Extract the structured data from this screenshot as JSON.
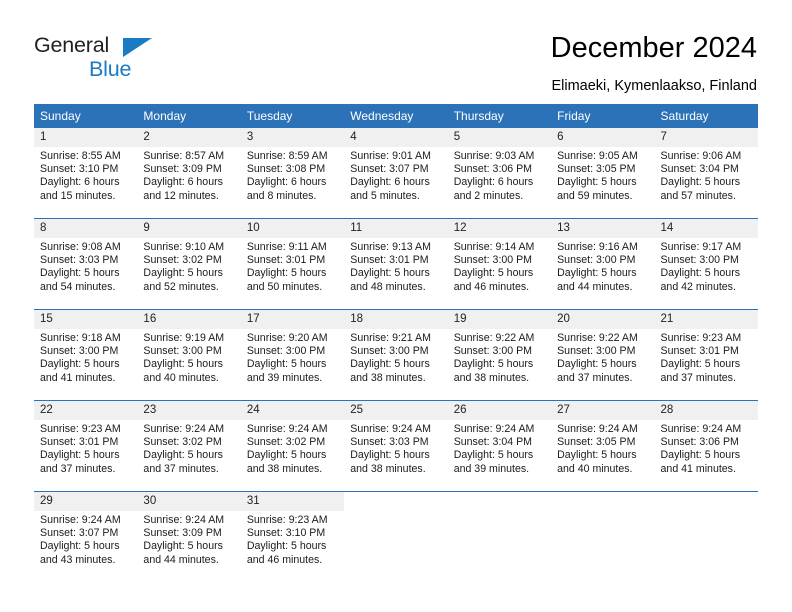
{
  "brand": {
    "name_dark": "General",
    "name_blue": "Blue",
    "accent_blue": "#1a7ac4",
    "header_blue": "#2c72b8",
    "daynum_bg": "#f0f0f0"
  },
  "header": {
    "title": "December 2024",
    "subtitle": "Elimaeki, Kymenlaakso, Finland"
  },
  "weekdays": [
    "Sunday",
    "Monday",
    "Tuesday",
    "Wednesday",
    "Thursday",
    "Friday",
    "Saturday"
  ],
  "weeks": [
    [
      {
        "day": "1",
        "sunrise": "Sunrise: 8:55 AM",
        "sunset": "Sunset: 3:10 PM",
        "daylight1": "Daylight: 6 hours",
        "daylight2": "and 15 minutes."
      },
      {
        "day": "2",
        "sunrise": "Sunrise: 8:57 AM",
        "sunset": "Sunset: 3:09 PM",
        "daylight1": "Daylight: 6 hours",
        "daylight2": "and 12 minutes."
      },
      {
        "day": "3",
        "sunrise": "Sunrise: 8:59 AM",
        "sunset": "Sunset: 3:08 PM",
        "daylight1": "Daylight: 6 hours",
        "daylight2": "and 8 minutes."
      },
      {
        "day": "4",
        "sunrise": "Sunrise: 9:01 AM",
        "sunset": "Sunset: 3:07 PM",
        "daylight1": "Daylight: 6 hours",
        "daylight2": "and 5 minutes."
      },
      {
        "day": "5",
        "sunrise": "Sunrise: 9:03 AM",
        "sunset": "Sunset: 3:06 PM",
        "daylight1": "Daylight: 6 hours",
        "daylight2": "and 2 minutes."
      },
      {
        "day": "6",
        "sunrise": "Sunrise: 9:05 AM",
        "sunset": "Sunset: 3:05 PM",
        "daylight1": "Daylight: 5 hours",
        "daylight2": "and 59 minutes."
      },
      {
        "day": "7",
        "sunrise": "Sunrise: 9:06 AM",
        "sunset": "Sunset: 3:04 PM",
        "daylight1": "Daylight: 5 hours",
        "daylight2": "and 57 minutes."
      }
    ],
    [
      {
        "day": "8",
        "sunrise": "Sunrise: 9:08 AM",
        "sunset": "Sunset: 3:03 PM",
        "daylight1": "Daylight: 5 hours",
        "daylight2": "and 54 minutes."
      },
      {
        "day": "9",
        "sunrise": "Sunrise: 9:10 AM",
        "sunset": "Sunset: 3:02 PM",
        "daylight1": "Daylight: 5 hours",
        "daylight2": "and 52 minutes."
      },
      {
        "day": "10",
        "sunrise": "Sunrise: 9:11 AM",
        "sunset": "Sunset: 3:01 PM",
        "daylight1": "Daylight: 5 hours",
        "daylight2": "and 50 minutes."
      },
      {
        "day": "11",
        "sunrise": "Sunrise: 9:13 AM",
        "sunset": "Sunset: 3:01 PM",
        "daylight1": "Daylight: 5 hours",
        "daylight2": "and 48 minutes."
      },
      {
        "day": "12",
        "sunrise": "Sunrise: 9:14 AM",
        "sunset": "Sunset: 3:00 PM",
        "daylight1": "Daylight: 5 hours",
        "daylight2": "and 46 minutes."
      },
      {
        "day": "13",
        "sunrise": "Sunrise: 9:16 AM",
        "sunset": "Sunset: 3:00 PM",
        "daylight1": "Daylight: 5 hours",
        "daylight2": "and 44 minutes."
      },
      {
        "day": "14",
        "sunrise": "Sunrise: 9:17 AM",
        "sunset": "Sunset: 3:00 PM",
        "daylight1": "Daylight: 5 hours",
        "daylight2": "and 42 minutes."
      }
    ],
    [
      {
        "day": "15",
        "sunrise": "Sunrise: 9:18 AM",
        "sunset": "Sunset: 3:00 PM",
        "daylight1": "Daylight: 5 hours",
        "daylight2": "and 41 minutes."
      },
      {
        "day": "16",
        "sunrise": "Sunrise: 9:19 AM",
        "sunset": "Sunset: 3:00 PM",
        "daylight1": "Daylight: 5 hours",
        "daylight2": "and 40 minutes."
      },
      {
        "day": "17",
        "sunrise": "Sunrise: 9:20 AM",
        "sunset": "Sunset: 3:00 PM",
        "daylight1": "Daylight: 5 hours",
        "daylight2": "and 39 minutes."
      },
      {
        "day": "18",
        "sunrise": "Sunrise: 9:21 AM",
        "sunset": "Sunset: 3:00 PM",
        "daylight1": "Daylight: 5 hours",
        "daylight2": "and 38 minutes."
      },
      {
        "day": "19",
        "sunrise": "Sunrise: 9:22 AM",
        "sunset": "Sunset: 3:00 PM",
        "daylight1": "Daylight: 5 hours",
        "daylight2": "and 38 minutes."
      },
      {
        "day": "20",
        "sunrise": "Sunrise: 9:22 AM",
        "sunset": "Sunset: 3:00 PM",
        "daylight1": "Daylight: 5 hours",
        "daylight2": "and 37 minutes."
      },
      {
        "day": "21",
        "sunrise": "Sunrise: 9:23 AM",
        "sunset": "Sunset: 3:01 PM",
        "daylight1": "Daylight: 5 hours",
        "daylight2": "and 37 minutes."
      }
    ],
    [
      {
        "day": "22",
        "sunrise": "Sunrise: 9:23 AM",
        "sunset": "Sunset: 3:01 PM",
        "daylight1": "Daylight: 5 hours",
        "daylight2": "and 37 minutes."
      },
      {
        "day": "23",
        "sunrise": "Sunrise: 9:24 AM",
        "sunset": "Sunset: 3:02 PM",
        "daylight1": "Daylight: 5 hours",
        "daylight2": "and 37 minutes."
      },
      {
        "day": "24",
        "sunrise": "Sunrise: 9:24 AM",
        "sunset": "Sunset: 3:02 PM",
        "daylight1": "Daylight: 5 hours",
        "daylight2": "and 38 minutes."
      },
      {
        "day": "25",
        "sunrise": "Sunrise: 9:24 AM",
        "sunset": "Sunset: 3:03 PM",
        "daylight1": "Daylight: 5 hours",
        "daylight2": "and 38 minutes."
      },
      {
        "day": "26",
        "sunrise": "Sunrise: 9:24 AM",
        "sunset": "Sunset: 3:04 PM",
        "daylight1": "Daylight: 5 hours",
        "daylight2": "and 39 minutes."
      },
      {
        "day": "27",
        "sunrise": "Sunrise: 9:24 AM",
        "sunset": "Sunset: 3:05 PM",
        "daylight1": "Daylight: 5 hours",
        "daylight2": "and 40 minutes."
      },
      {
        "day": "28",
        "sunrise": "Sunrise: 9:24 AM",
        "sunset": "Sunset: 3:06 PM",
        "daylight1": "Daylight: 5 hours",
        "daylight2": "and 41 minutes."
      }
    ],
    [
      {
        "day": "29",
        "sunrise": "Sunrise: 9:24 AM",
        "sunset": "Sunset: 3:07 PM",
        "daylight1": "Daylight: 5 hours",
        "daylight2": "and 43 minutes."
      },
      {
        "day": "30",
        "sunrise": "Sunrise: 9:24 AM",
        "sunset": "Sunset: 3:09 PM",
        "daylight1": "Daylight: 5 hours",
        "daylight2": "and 44 minutes."
      },
      {
        "day": "31",
        "sunrise": "Sunrise: 9:23 AM",
        "sunset": "Sunset: 3:10 PM",
        "daylight1": "Daylight: 5 hours",
        "daylight2": "and 46 minutes."
      },
      {
        "day": "",
        "sunrise": "",
        "sunset": "",
        "daylight1": "",
        "daylight2": ""
      },
      {
        "day": "",
        "sunrise": "",
        "sunset": "",
        "daylight1": "",
        "daylight2": ""
      },
      {
        "day": "",
        "sunrise": "",
        "sunset": "",
        "daylight1": "",
        "daylight2": ""
      },
      {
        "day": "",
        "sunrise": "",
        "sunset": "",
        "daylight1": "",
        "daylight2": ""
      }
    ]
  ]
}
